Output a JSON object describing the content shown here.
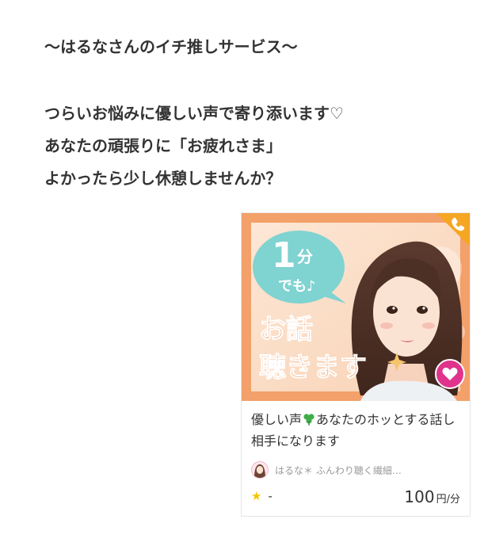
{
  "intro": {
    "line1": "〜はるなさんのイチ推しサービス〜",
    "line2": "つらいお悩みに優しい声で寄り添います♡",
    "line3": "あなたの頑張りに「お疲れさま」",
    "line4": "よかったら少し休憩しませんか？"
  },
  "card": {
    "banner": {
      "bubble_number": "1",
      "bubble_unit": "分",
      "bubble_sub": "でも♪",
      "text_line1": "お話",
      "text_line2": "聴きます"
    },
    "title_part1": "優しい声",
    "title_part2": "あなたのホッとする話し相手になります",
    "seller_name": "はるな＊ ふんわり聴く繊細…",
    "rating": "-",
    "price_value": "100",
    "price_unit": "円/分",
    "icons": {
      "call": "phone-icon",
      "favorite": "heart-icon",
      "rating": "star-icon",
      "title_emoji": "clover-icon"
    }
  },
  "colors": {
    "heading_text": "#333333",
    "banner_orange": "#f3a06a",
    "bubble_teal": "#7fd3d1",
    "favorite_pink": "#e0338c",
    "call_badge_orange": "#f5a623",
    "star_yellow": "#f5c500",
    "muted_text": "#999999"
  }
}
